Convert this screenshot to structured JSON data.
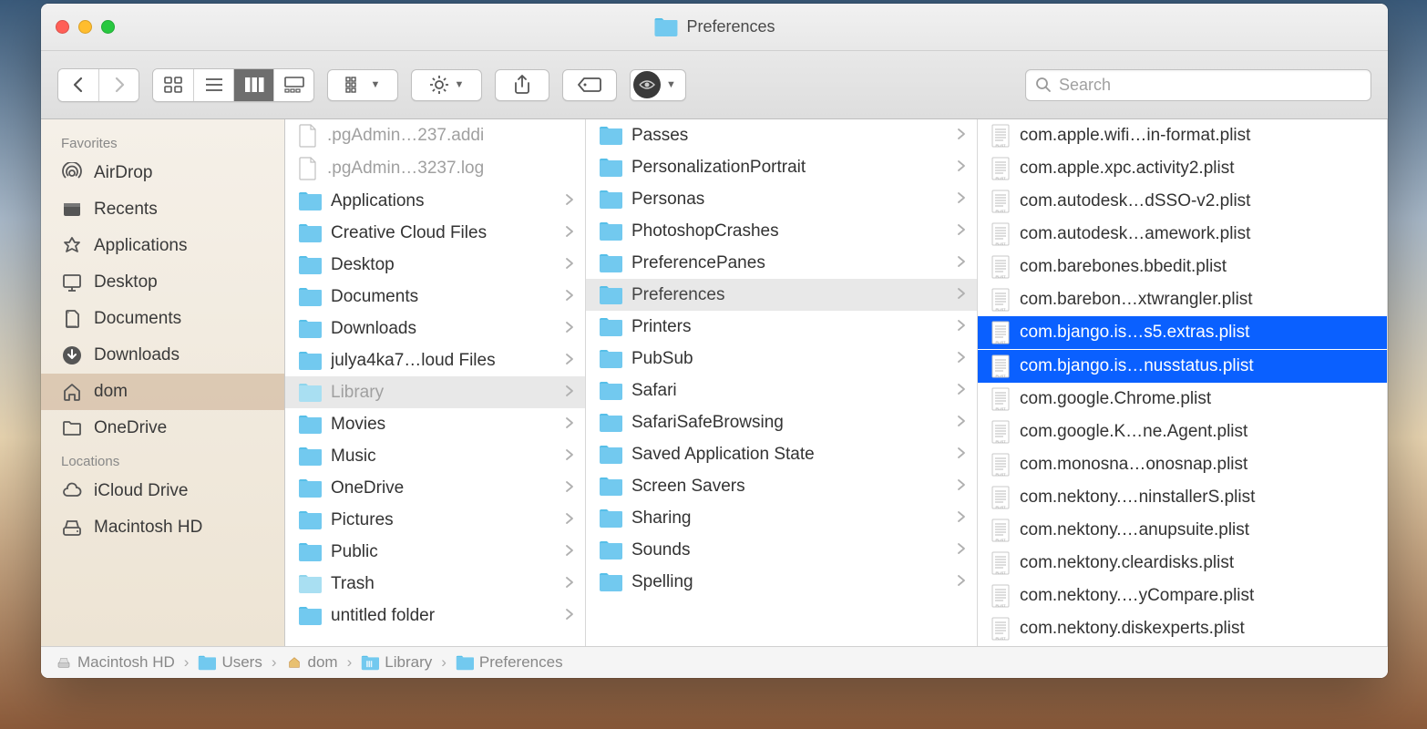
{
  "window": {
    "title": "Preferences"
  },
  "toolbar": {
    "search_placeholder": "Search"
  },
  "sidebar": {
    "sections": [
      {
        "header": "Favorites",
        "items": [
          {
            "label": "AirDrop",
            "icon": "airdrop"
          },
          {
            "label": "Recents",
            "icon": "recents"
          },
          {
            "label": "Applications",
            "icon": "applications"
          },
          {
            "label": "Desktop",
            "icon": "desktop"
          },
          {
            "label": "Documents",
            "icon": "documents"
          },
          {
            "label": "Downloads",
            "icon": "downloads"
          },
          {
            "label": "dom",
            "icon": "home",
            "selected": true
          },
          {
            "label": "OneDrive",
            "icon": "folder"
          }
        ]
      },
      {
        "header": "Locations",
        "items": [
          {
            "label": "iCloud Drive",
            "icon": "icloud"
          },
          {
            "label": "Macintosh HD",
            "icon": "disk"
          }
        ]
      }
    ]
  },
  "columns": [
    {
      "items": [
        {
          "label": ".pgAdmin…237.addi",
          "type": "file",
          "dimmed": true
        },
        {
          "label": ".pgAdmin…3237.log",
          "type": "file",
          "dimmed": true
        },
        {
          "label": "Applications",
          "type": "folder",
          "arrow": true
        },
        {
          "label": "Creative Cloud Files",
          "type": "folder",
          "arrow": true
        },
        {
          "label": "Desktop",
          "type": "folder",
          "arrow": true
        },
        {
          "label": "Documents",
          "type": "folder",
          "arrow": true
        },
        {
          "label": "Downloads",
          "type": "folder",
          "arrow": true
        },
        {
          "label": "julya4ka7…loud Files",
          "type": "folder",
          "arrow": true
        },
        {
          "label": "Library",
          "type": "folder",
          "arrow": true,
          "selectedPath": true,
          "muted": true
        },
        {
          "label": "Movies",
          "type": "folder",
          "arrow": true
        },
        {
          "label": "Music",
          "type": "folder",
          "arrow": true
        },
        {
          "label": "OneDrive",
          "type": "folder",
          "arrow": true
        },
        {
          "label": "Pictures",
          "type": "folder",
          "arrow": true
        },
        {
          "label": "Public",
          "type": "folder",
          "arrow": true
        },
        {
          "label": "Trash",
          "type": "folder",
          "arrow": true,
          "muted": true
        },
        {
          "label": "untitled folder",
          "type": "folder",
          "arrow": true
        }
      ]
    },
    {
      "items": [
        {
          "label": "Passes",
          "type": "folder",
          "arrow": true
        },
        {
          "label": "PersonalizationPortrait",
          "type": "folder",
          "arrow": true
        },
        {
          "label": "Personas",
          "type": "folder",
          "arrow": true
        },
        {
          "label": "PhotoshopCrashes",
          "type": "folder",
          "arrow": true
        },
        {
          "label": "PreferencePanes",
          "type": "folder",
          "arrow": true
        },
        {
          "label": "Preferences",
          "type": "folder",
          "arrow": true,
          "selectedPath": true
        },
        {
          "label": "Printers",
          "type": "folder",
          "arrow": true
        },
        {
          "label": "PubSub",
          "type": "folder",
          "arrow": true
        },
        {
          "label": "Safari",
          "type": "folder",
          "arrow": true
        },
        {
          "label": "SafariSafeBrowsing",
          "type": "folder",
          "arrow": true
        },
        {
          "label": "Saved Application State",
          "type": "folder",
          "arrow": true
        },
        {
          "label": "Screen Savers",
          "type": "folder",
          "arrow": true
        },
        {
          "label": "Sharing",
          "type": "folder",
          "arrow": true
        },
        {
          "label": "Sounds",
          "type": "folder",
          "arrow": true
        },
        {
          "label": "Spelling",
          "type": "folder",
          "arrow": true
        }
      ]
    },
    {
      "items": [
        {
          "label": "com.apple.wifi…in-format.plist",
          "type": "plist",
          "cut": true
        },
        {
          "label": "com.apple.xpc.activity2.plist",
          "type": "plist"
        },
        {
          "label": "com.autodesk…dSSO-v2.plist",
          "type": "plist"
        },
        {
          "label": "com.autodesk…amework.plist",
          "type": "plist"
        },
        {
          "label": "com.barebones.bbedit.plist",
          "type": "plist"
        },
        {
          "label": "com.barebon…xtwrangler.plist",
          "type": "plist"
        },
        {
          "label": "com.bjango.is…s5.extras.plist",
          "type": "plist",
          "selectedFile": true
        },
        {
          "label": "com.bjango.is…nusstatus.plist",
          "type": "plist",
          "selectedFile": true
        },
        {
          "label": "com.google.Chrome.plist",
          "type": "plist"
        },
        {
          "label": "com.google.K…ne.Agent.plist",
          "type": "plist"
        },
        {
          "label": "com.monosna…onosnap.plist",
          "type": "plist"
        },
        {
          "label": "com.nektony.…ninstallerS.plist",
          "type": "plist"
        },
        {
          "label": "com.nektony.…anupsuite.plist",
          "type": "plist"
        },
        {
          "label": "com.nektony.cleardisks.plist",
          "type": "plist"
        },
        {
          "label": "com.nektony.…yCompare.plist",
          "type": "plist"
        },
        {
          "label": "com.nektony.diskexperts.plist",
          "type": "plist"
        }
      ]
    }
  ],
  "pathbar": [
    {
      "label": "Macintosh HD",
      "icon": "disk"
    },
    {
      "label": "Users",
      "icon": "folder"
    },
    {
      "label": "dom",
      "icon": "home"
    },
    {
      "label": "Library",
      "icon": "library"
    },
    {
      "label": "Preferences",
      "icon": "folder"
    }
  ]
}
